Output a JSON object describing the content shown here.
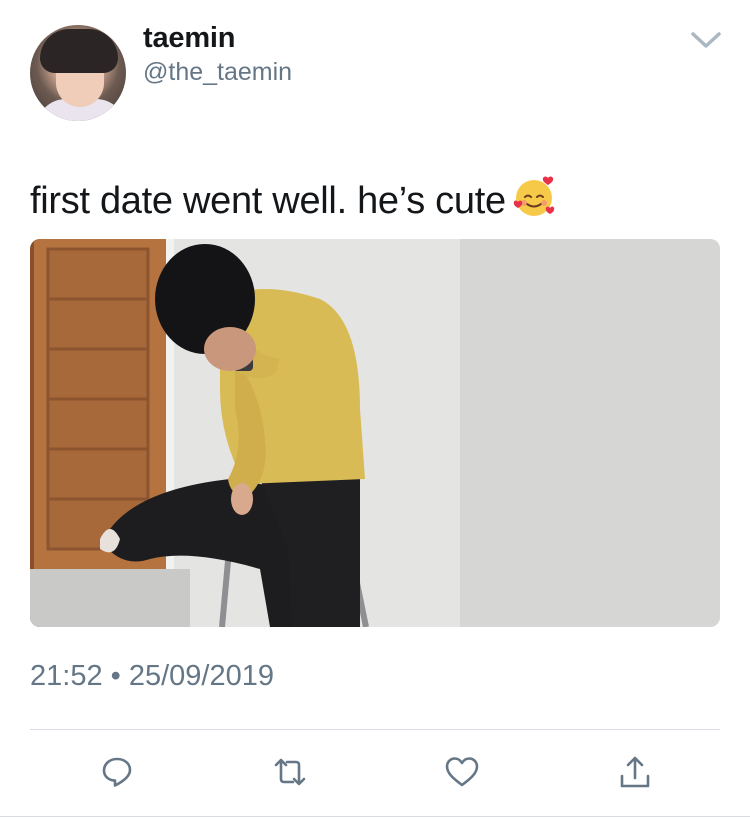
{
  "user": {
    "display_name": "taemin",
    "handle": "@the_taemin"
  },
  "tweet": {
    "text": "first date went well. he’s cute",
    "emoji": "smiling-face-with-hearts-icon",
    "timestamp": "21:52 • 25/09/2019"
  },
  "actions": [
    "reply-icon",
    "retweet-icon",
    "like-icon",
    "share-icon"
  ],
  "colors": {
    "text": "#14171a",
    "secondary": "#657786",
    "divider": "#d7dde2"
  }
}
